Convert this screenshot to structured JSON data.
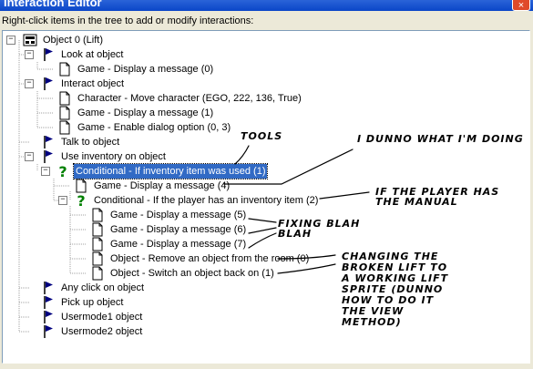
{
  "window": {
    "title": "Interaction Editor",
    "close_glyph": "×"
  },
  "instruction": "Right-click items in the tree to add or modify interactions:",
  "tree": {
    "root": "Object 0 (Lift)",
    "look": "Look at object",
    "look_cmd": "Game - Display a message (0)",
    "interact": "Interact object",
    "interact_cmd1": "Character - Move character (EGO, 222, 136, True)",
    "interact_cmd2": "Game - Display a message (1)",
    "interact_cmd3": "Game - Enable dialog option (0, 3)",
    "talk": "Talk to object",
    "useinv": "Use inventory on object",
    "cond1": "Conditional - If inventory item was used (1)",
    "cond1_cmd": "Game - Display a message (4)",
    "cond2": "Conditional - If the player has an inventory item (2)",
    "cond2_cmd1": "Game - Display a message (5)",
    "cond2_cmd2": "Game - Display a message (6)",
    "cond2_cmd3": "Game - Display a message (7)",
    "cond2_cmd4": "Object - Remove an object from the room (0)",
    "cond2_cmd5": "Object - Switch an object back on (1)",
    "anyclick": "Any click on object",
    "pickup": "Pick up object",
    "usermode1": "Usermode1 object",
    "usermode2": "Usermode2 object"
  },
  "annotations": {
    "tools": "Tools",
    "dunno": "I dunno what I'm doing",
    "manual_1": "If the player has",
    "manual_2": "the manual",
    "blah_1": "Fixing blah",
    "blah_2": "blah",
    "sprite_1": "Changing the",
    "sprite_2": "broken lift to",
    "sprite_3": "a working lift",
    "sprite_4": "sprite (dunno",
    "sprite_5": "how to do it",
    "sprite_6": "the view",
    "sprite_7": "method)"
  },
  "colors": {
    "selection": "#316ac5",
    "flag": "#00007f",
    "question": "#008000"
  }
}
